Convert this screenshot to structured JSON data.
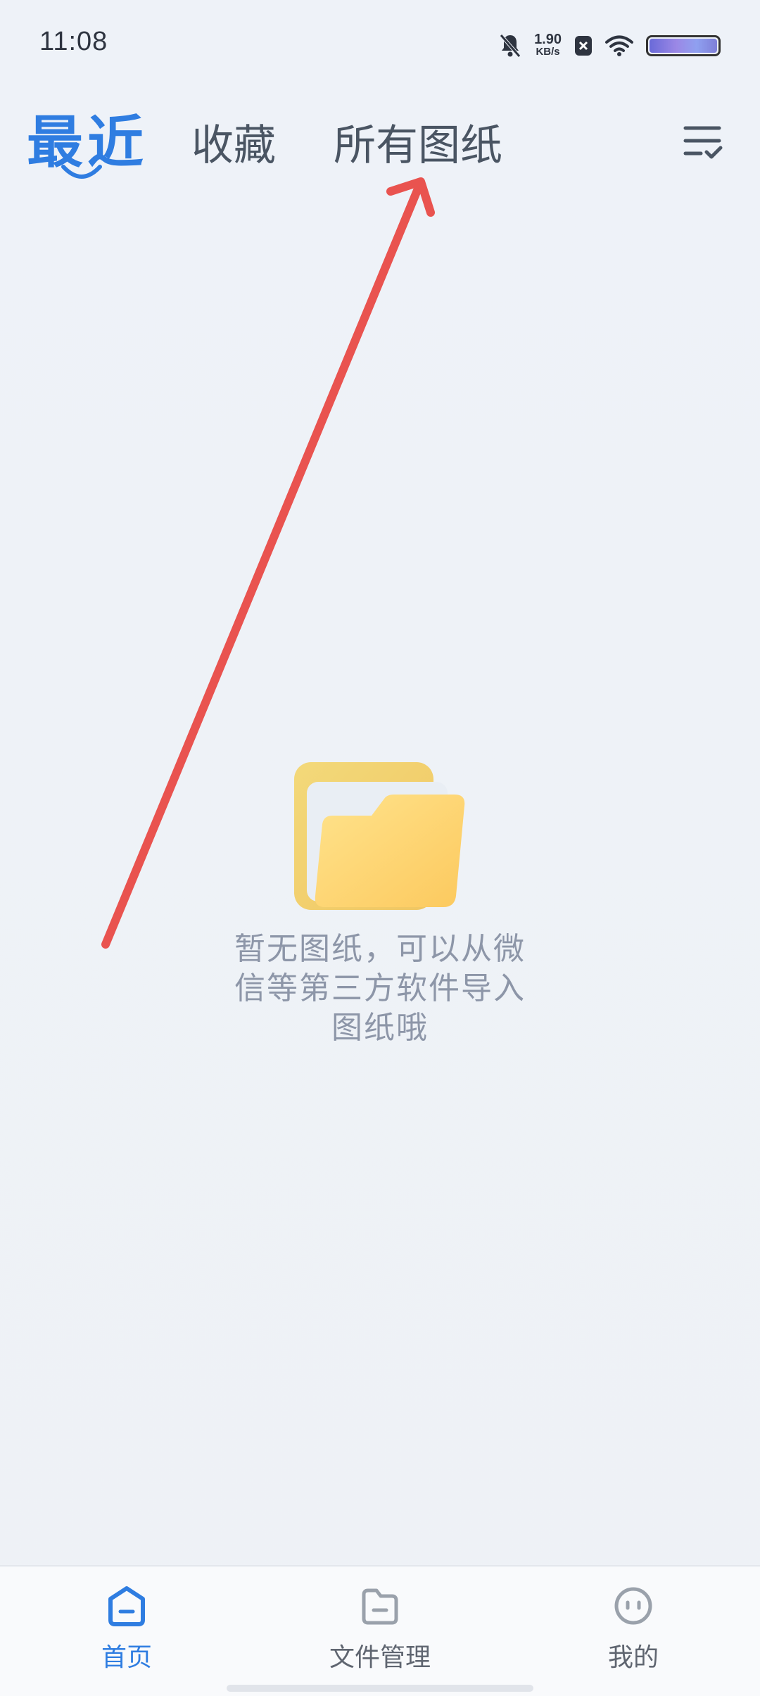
{
  "status_bar": {
    "time": "11:08",
    "net_speed_value": "1.90",
    "net_speed_unit": "KB/s",
    "icons": [
      "bell-muted-icon",
      "close-badge-icon",
      "wifi-icon",
      "battery-icon"
    ]
  },
  "tabs": [
    {
      "label": "最近",
      "active": true
    },
    {
      "label": "收藏",
      "active": false
    },
    {
      "label": "所有图纸",
      "active": false
    }
  ],
  "empty_state": {
    "message": "暂无图纸，可以从微信等第三方软件导入图纸哦"
  },
  "bottom_nav": [
    {
      "label": "首页",
      "icon": "home-icon",
      "active": true
    },
    {
      "label": "文件管理",
      "icon": "folder-icon",
      "active": false
    },
    {
      "label": "我的",
      "icon": "profile-icon",
      "active": false
    }
  ],
  "colors": {
    "accent": "#2f7de1",
    "annotation_arrow": "#e9534f",
    "muted_text": "#8d96a8"
  }
}
